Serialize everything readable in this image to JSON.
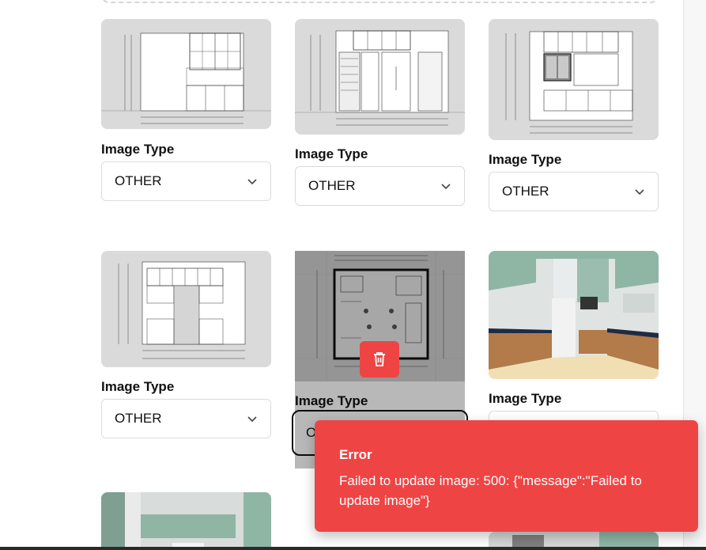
{
  "gallery": {
    "items": [
      {
        "type_label": "Image Type",
        "selected": "OTHER",
        "thumb_icon": "kitchen-elevation-drawing"
      },
      {
        "type_label": "Image Type",
        "selected": "OTHER",
        "thumb_icon": "kitchen-elevation-drawing"
      },
      {
        "type_label": "Image Type",
        "selected": "OTHER",
        "thumb_icon": "kitchen-elevation-drawing"
      },
      {
        "type_label": "Image Type",
        "selected": "OTHER",
        "thumb_icon": "kitchen-elevation-drawing"
      },
      {
        "type_label": "Image Type",
        "selected": "O",
        "thumb_icon": "kitchen-floor-plan"
      },
      {
        "type_label": "Image Type",
        "selected": "",
        "thumb_icon": "kitchen-3d-render"
      }
    ]
  },
  "toast": {
    "title": "Error",
    "message": "Failed to update image: 500: {\"message\":\"Failed to update image\"}"
  },
  "colors": {
    "error": "#ef4444",
    "cabinet_green": "#8fb5a5",
    "thumb_bg": "#d9d9d9"
  },
  "icons": {
    "select_chevron": "chevron-down-icon",
    "delete": "trash-icon"
  }
}
